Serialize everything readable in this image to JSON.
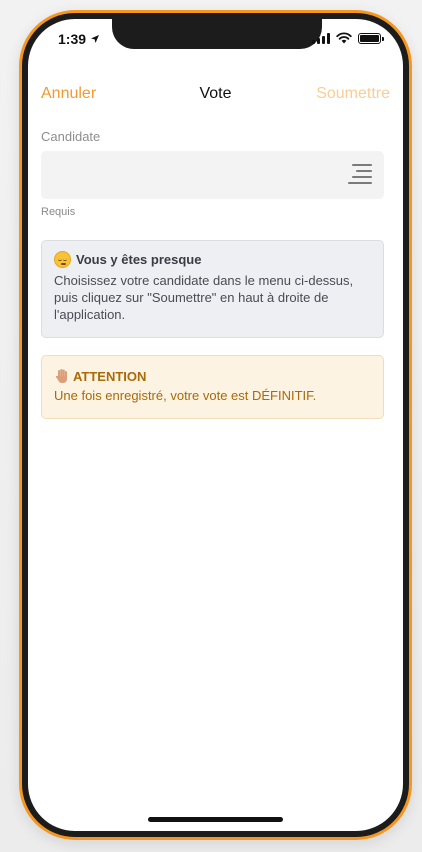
{
  "status_bar": {
    "time": "1:39"
  },
  "navbar": {
    "cancel_label": "Annuler",
    "title": "Vote",
    "submit_label": "Soumettre"
  },
  "form": {
    "field_label": "Candidate",
    "field_value": "",
    "required_text": "Requis"
  },
  "info_box": {
    "title": "Vous y êtes presque",
    "body": "Choisissez votre candidate dans le menu ci-dessus, puis cliquez sur \"Soumettre\" en haut à droite de l'application.",
    "icon": "relieved-face-icon"
  },
  "warning_box": {
    "title": "ATTENTION",
    "body": "Une fois enregistré, votre vote est DÉFINITIF.",
    "icon": "raised-hand-icon"
  },
  "colors": {
    "accent": "#f29a2e",
    "accent_disabled": "#f8cd96",
    "phone_frame": "#f5961e",
    "warning_text": "#a86a0a",
    "warning_bg": "#fdf3e3",
    "info_bg": "#eeeff2"
  }
}
